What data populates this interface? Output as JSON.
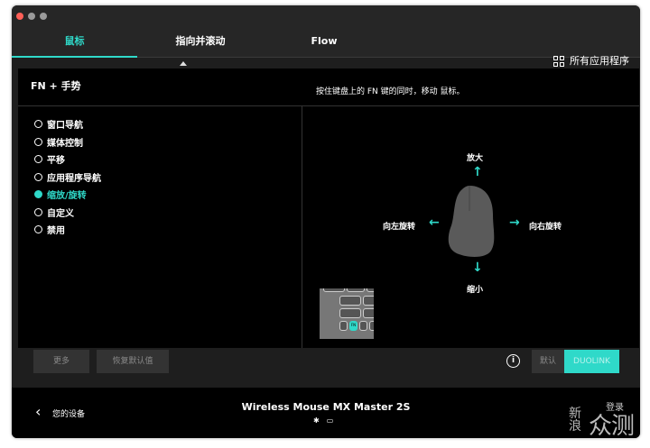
{
  "tabs": [
    "鼠标",
    "指向并滚动",
    "Flow"
  ],
  "all_apps": "所有应用程序",
  "panel": {
    "title": "FN + 手势",
    "description": "按住键盘上的 FN 键的同时，移动 鼠标。"
  },
  "options": [
    "窗口导航",
    "媒体控制",
    "平移",
    "应用程序导航",
    "缩放/旋转",
    "自定义",
    "禁用"
  ],
  "selected_option": "缩放/旋转",
  "gestures": {
    "up": "放大",
    "down": "缩小",
    "left": "向左旋转",
    "right": "向右旋转"
  },
  "fn_key": "FN",
  "footer": {
    "more": "更多",
    "restore": "恢复默认值",
    "info": "i",
    "default": "默认",
    "duolink": "DUOLINK"
  },
  "device": {
    "back_label": "您的设备",
    "name": "Wireless Mouse MX Master 2S",
    "right_label": "登录"
  },
  "watermark": {
    "top": "新",
    "bottom": "浪",
    "big": "众测"
  },
  "colors": {
    "accent": "#2fd9c9",
    "bg": "#1e1e1e",
    "panel": "#000000"
  }
}
